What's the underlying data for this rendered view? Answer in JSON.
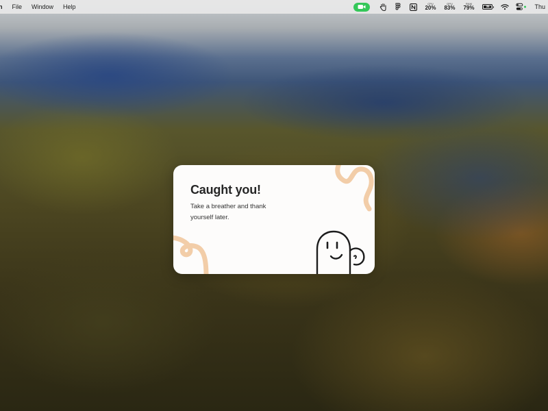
{
  "menubar": {
    "items": [
      "n",
      "File",
      "Window",
      "Help"
    ],
    "icons": [
      "facetime-camera-icon",
      "hand-icon",
      "figma-icon",
      "notion-icon"
    ],
    "stats": [
      {
        "label": "CPU",
        "value": "20%"
      },
      {
        "label": "GPU",
        "value": "83%"
      },
      {
        "label": "RAM",
        "value": "79%"
      }
    ],
    "battery": "35",
    "clock": "Thu",
    "accent": "#34c759"
  },
  "card": {
    "title": "Caught you!",
    "body": "Take a breather and thank yourself later.",
    "accent": "#f2cda8"
  }
}
